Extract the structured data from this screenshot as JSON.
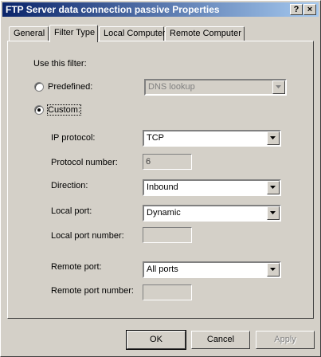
{
  "window": {
    "title": "FTP Server data connection passive Properties"
  },
  "titlebar_buttons": {
    "help": "?",
    "close": "×"
  },
  "tabs": [
    {
      "label": "General"
    },
    {
      "label": "Filter Type"
    },
    {
      "label": "Local Computer"
    },
    {
      "label": "Remote Computer"
    }
  ],
  "filter": {
    "use_label": "Use this filter:",
    "predefined_label": "Predefined:",
    "predefined_value": "DNS lookup",
    "custom_label": "Custom:",
    "ip_protocol_label": "IP protocol:",
    "ip_protocol_value": "TCP",
    "protocol_number_label": "Protocol number:",
    "protocol_number_value": "6",
    "direction_label": "Direction:",
    "direction_value": "Inbound",
    "local_port_label": "Local port:",
    "local_port_value": "Dynamic",
    "local_port_number_label": "Local port number:",
    "local_port_number_value": "",
    "remote_port_label": "Remote port:",
    "remote_port_value": "All ports",
    "remote_port_number_label": "Remote port number:",
    "remote_port_number_value": ""
  },
  "buttons": {
    "ok": "OK",
    "cancel": "Cancel",
    "apply": "Apply"
  }
}
